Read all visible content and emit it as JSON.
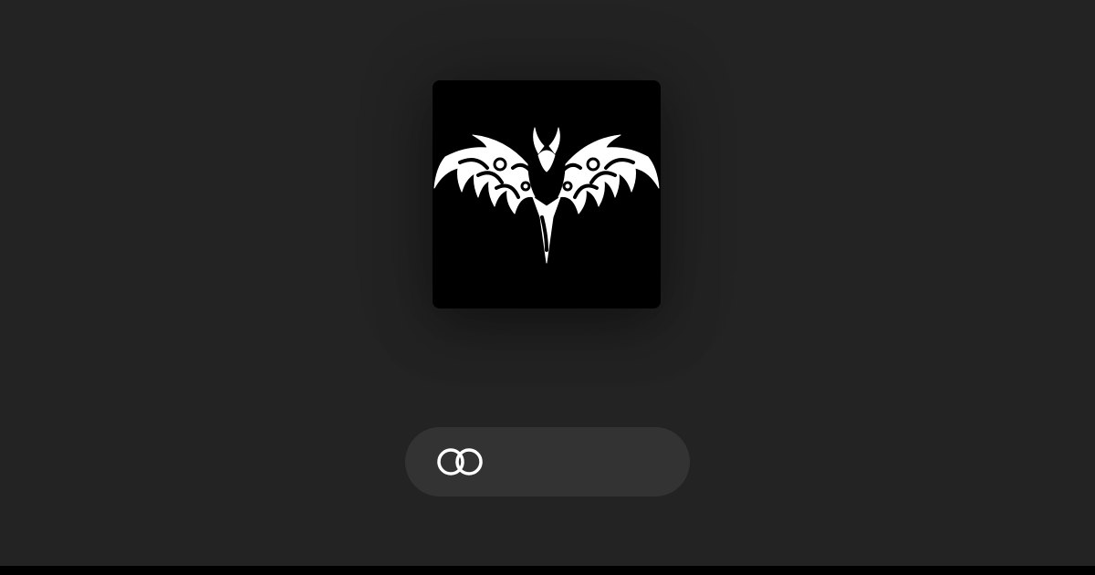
{
  "avatar": {
    "icon": "tribal-bat-logo",
    "background_color": "#000000",
    "foreground_color": "#ffffff"
  },
  "link_button": {
    "icon": "link-rings-icon",
    "label": ""
  },
  "colors": {
    "page_background": "#232323",
    "pill_background": "#333333"
  }
}
